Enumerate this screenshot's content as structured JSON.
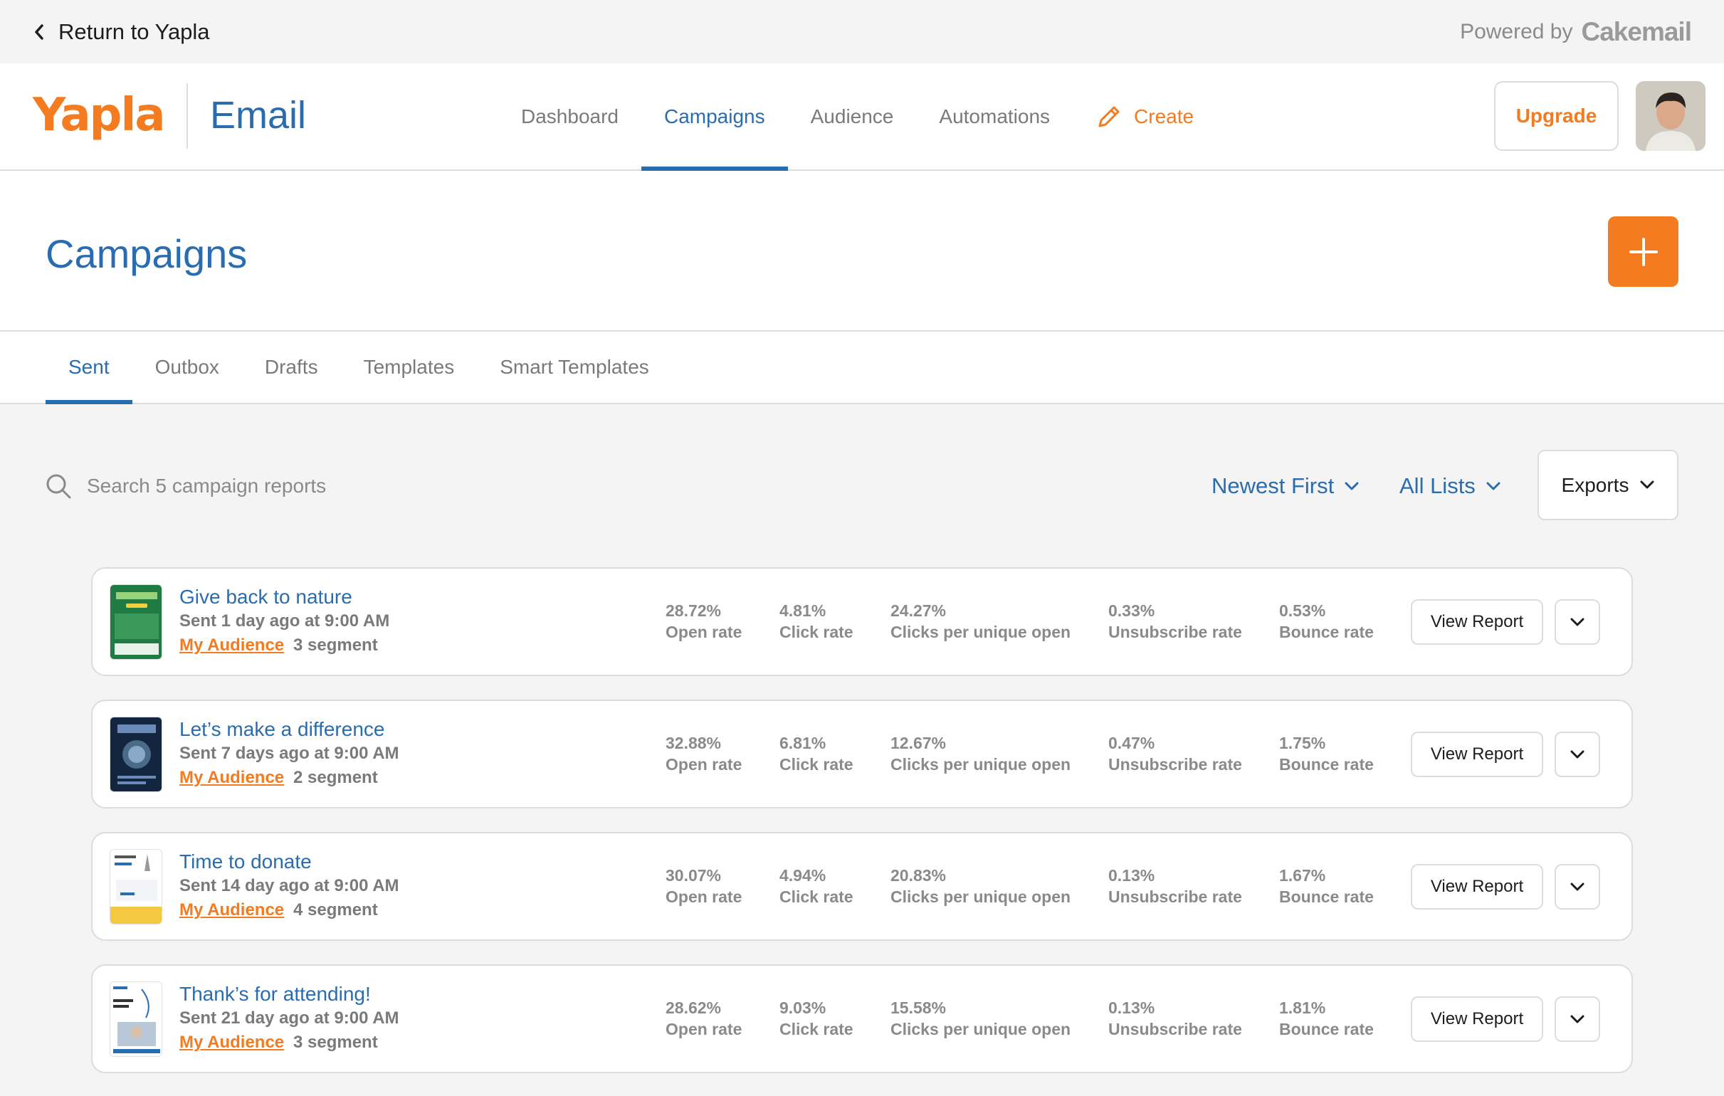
{
  "topbar": {
    "return_label": "Return to Yapla",
    "powered_by": "Powered by",
    "powered_brand": "Cakemail"
  },
  "header": {
    "logo": "Yapla",
    "product": "Email",
    "nav": [
      {
        "label": "Dashboard",
        "active": false
      },
      {
        "label": "Campaigns",
        "active": true
      },
      {
        "label": "Audience",
        "active": false
      },
      {
        "label": "Automations",
        "active": false
      }
    ],
    "create_label": "Create",
    "upgrade_label": "Upgrade"
  },
  "page": {
    "title": "Campaigns",
    "add_icon": "plus-icon"
  },
  "tabs": [
    {
      "label": "Sent",
      "active": true
    },
    {
      "label": "Outbox",
      "active": false
    },
    {
      "label": "Drafts",
      "active": false
    },
    {
      "label": "Templates",
      "active": false
    },
    {
      "label": "Smart Templates",
      "active": false
    }
  ],
  "filters": {
    "search_placeholder": "Search 5 campaign reports",
    "sort_label": "Newest First",
    "lists_label": "All Lists",
    "exports_label": "Exports"
  },
  "colors": {
    "accent": "#2a6cb0",
    "brand_orange": "#f47b1f"
  },
  "campaigns": [
    {
      "title": "Give back to nature",
      "sent": "Sent 1 day ago at 9:00 AM",
      "audience": "My Audience",
      "segment": "3 segment",
      "open_rate": "28.72%",
      "click_rate": "4.81%",
      "cpuo": "24.27%",
      "unsub_rate": "0.33%",
      "bounce_rate": "0.53%"
    },
    {
      "title": "Let’s make a difference",
      "sent": "Sent 7 days ago at 9:00 AM",
      "audience": "My Audience",
      "segment": "2 segment",
      "open_rate": "32.88%",
      "click_rate": "6.81%",
      "cpuo": "12.67%",
      "unsub_rate": "0.47%",
      "bounce_rate": "1.75%"
    },
    {
      "title": "Time to donate",
      "sent": "Sent 14 day ago at 9:00 AM",
      "audience": "My Audience",
      "segment": "4 segment",
      "open_rate": "30.07%",
      "click_rate": "4.94%",
      "cpuo": "20.83%",
      "unsub_rate": "0.13%",
      "bounce_rate": "1.67%"
    },
    {
      "title": "Thank’s for attending!",
      "sent": "Sent 21 day ago at 9:00 AM",
      "audience": "My Audience",
      "segment": "3 segment",
      "open_rate": "28.62%",
      "click_rate": "9.03%",
      "cpuo": "15.58%",
      "unsub_rate": "0.13%",
      "bounce_rate": "1.81%"
    }
  ],
  "labels": {
    "open_rate": "Open rate",
    "click_rate": "Click rate",
    "cpuo": "Clicks per unique open",
    "unsub_rate": "Unsubscribe rate",
    "bounce_rate": "Bounce rate",
    "view_report": "View Report"
  }
}
